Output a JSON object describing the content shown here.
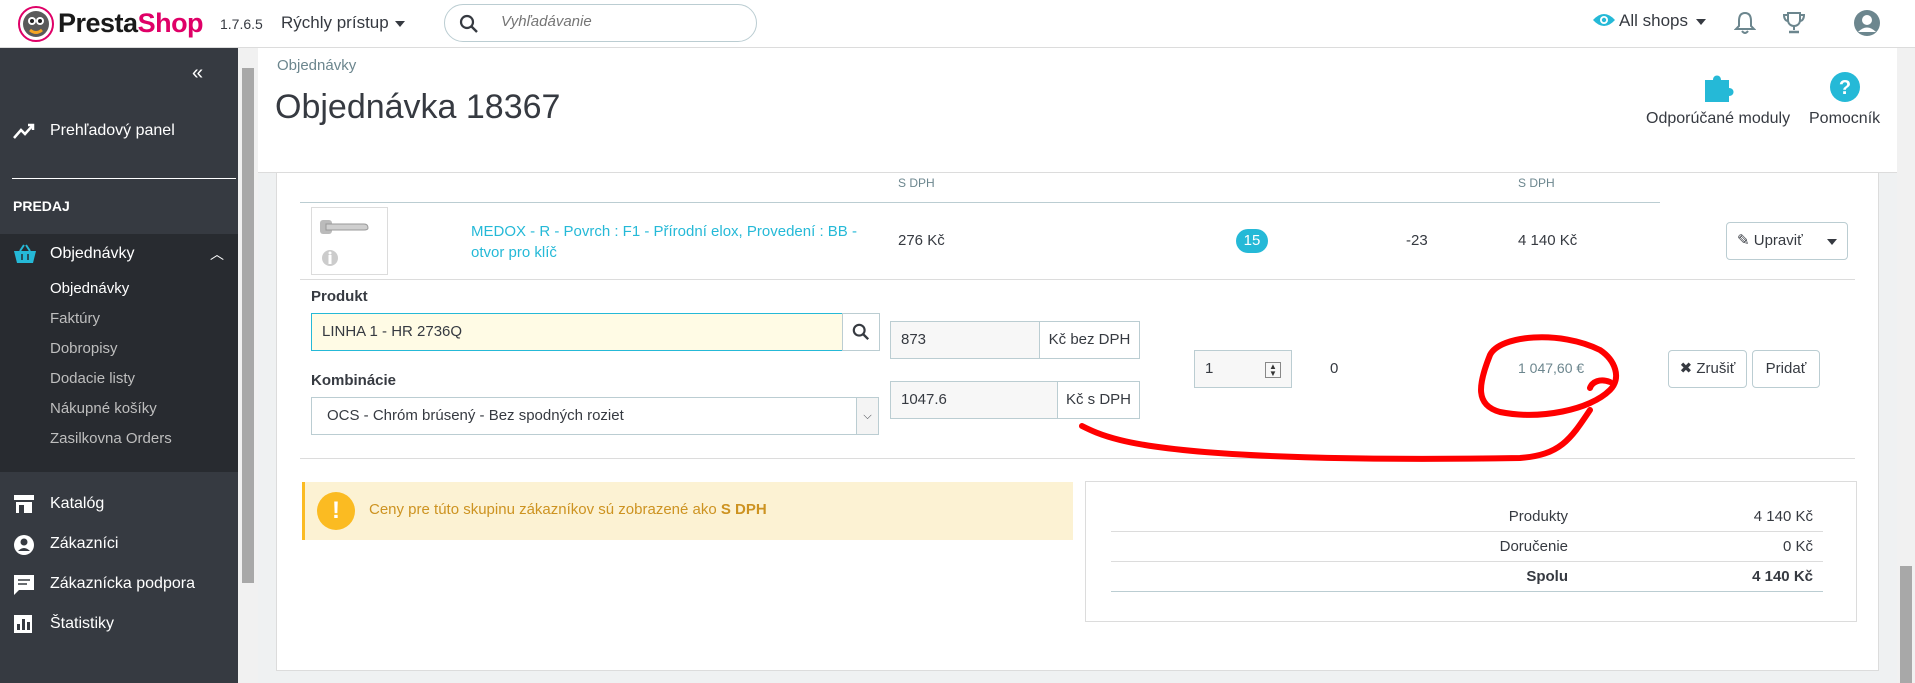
{
  "topbar": {
    "logo_presta": "Presta",
    "logo_shop": "Shop",
    "version": "1.7.6.5",
    "quick_access": "Rýchly prístup",
    "search_placeholder": "Vyhľadávanie",
    "all_shops": "All shops"
  },
  "sidebar": {
    "dashboard": "Prehľadový panel",
    "section_sell": "PREDAJ",
    "orders": "Objednávky",
    "orders_sub": [
      "Objednávky",
      "Faktúry",
      "Dobropisy",
      "Dodacie listy",
      "Nákupné košíky",
      "Zasilkovna Orders"
    ],
    "catalog": "Katalóg",
    "customers": "Zákazníci",
    "support": "Zákaznícka podpora",
    "stats": "Štatistiky"
  },
  "header": {
    "breadcrumb": "Objednávky",
    "title": "Objednávka 18367",
    "recommended_modules": "Odporúčané moduly",
    "help": "Pomocník"
  },
  "table": {
    "th_price_tax": "S DPH",
    "th_total_tax": "S DPH",
    "row": {
      "name": "MEDOX - R - Povrch : F1 - Přírodní elox, Provedení : BB - otvor pro klíč",
      "unit_price": "276 Kč",
      "qty": "15",
      "refunded": "-23",
      "total": "4 140 Kč",
      "edit_label": "Upraviť"
    }
  },
  "add_product": {
    "product_label": "Produkt",
    "product_value": "LINHA 1 - HR 2736Q",
    "combination_label": "Kombinácie",
    "combination_value": "OCS - Chróm brúsený - Bez spodných roziet",
    "price_excl": "873",
    "price_excl_addon": "Kč bez DPH",
    "price_incl": "1047.6",
    "price_incl_addon": "Kč s DPH",
    "qty": "1",
    "stock": "0",
    "total": "1 047,60 €",
    "cancel_label": "Zrušiť",
    "add_label": "Pridať"
  },
  "alert": {
    "text": "Ceny pre túto skupinu zákazníkov sú zobrazené ako ",
    "strong": "S DPH"
  },
  "summary": {
    "rows": [
      {
        "label": "Produkty",
        "value": "4 140 Kč"
      },
      {
        "label": "Doručenie",
        "value": "0 Kč"
      },
      {
        "label": "Spolu",
        "value": "4 140 Kč"
      }
    ]
  },
  "colors": {
    "accent": "#25b9d7",
    "sidebar_bg": "#363a41",
    "brand_pink": "#df0067",
    "annotation_red": "#ff0000",
    "warning": "#fbbb22"
  }
}
